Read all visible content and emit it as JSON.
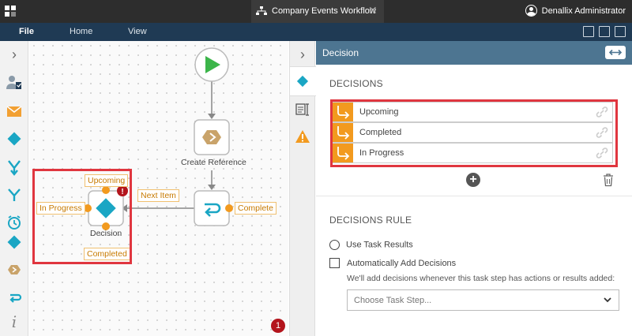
{
  "window": {
    "doc_title": "Company Events Workflow",
    "user_name": "Denallix Administrator"
  },
  "menu": {
    "file": "File",
    "home": "Home",
    "view": "View"
  },
  "canvas": {
    "create_reference_caption": "Create Reference",
    "decision_caption": "Decision",
    "next_item_label": "Next Item",
    "complete_label": "Complete",
    "upcoming_label": "Upcoming",
    "in_progress_label": "In Progress",
    "completed_label": "Completed",
    "error_badge": "!",
    "issue_count": "1"
  },
  "panel": {
    "title": "Decision",
    "decisions_heading": "DECISIONS",
    "decisions": [
      {
        "label": "Upcoming"
      },
      {
        "label": "Completed"
      },
      {
        "label": "In Progress"
      }
    ],
    "add_symbol": "+",
    "rule_heading": "DECISIONS RULE",
    "radio_label": "Use Task Results",
    "auto_add_label": "Automatically Add Decisions",
    "help_text": "We'll add decisions whenever this task step has actions or results added:",
    "select_placeholder": "Choose Task Step..."
  },
  "colors": {
    "accent_orange": "#f29a1f",
    "decision_teal": "#1aa6c4",
    "start_green": "#3cb54a",
    "highlight_red": "#e0363f",
    "header_blue": "#4d7591"
  }
}
